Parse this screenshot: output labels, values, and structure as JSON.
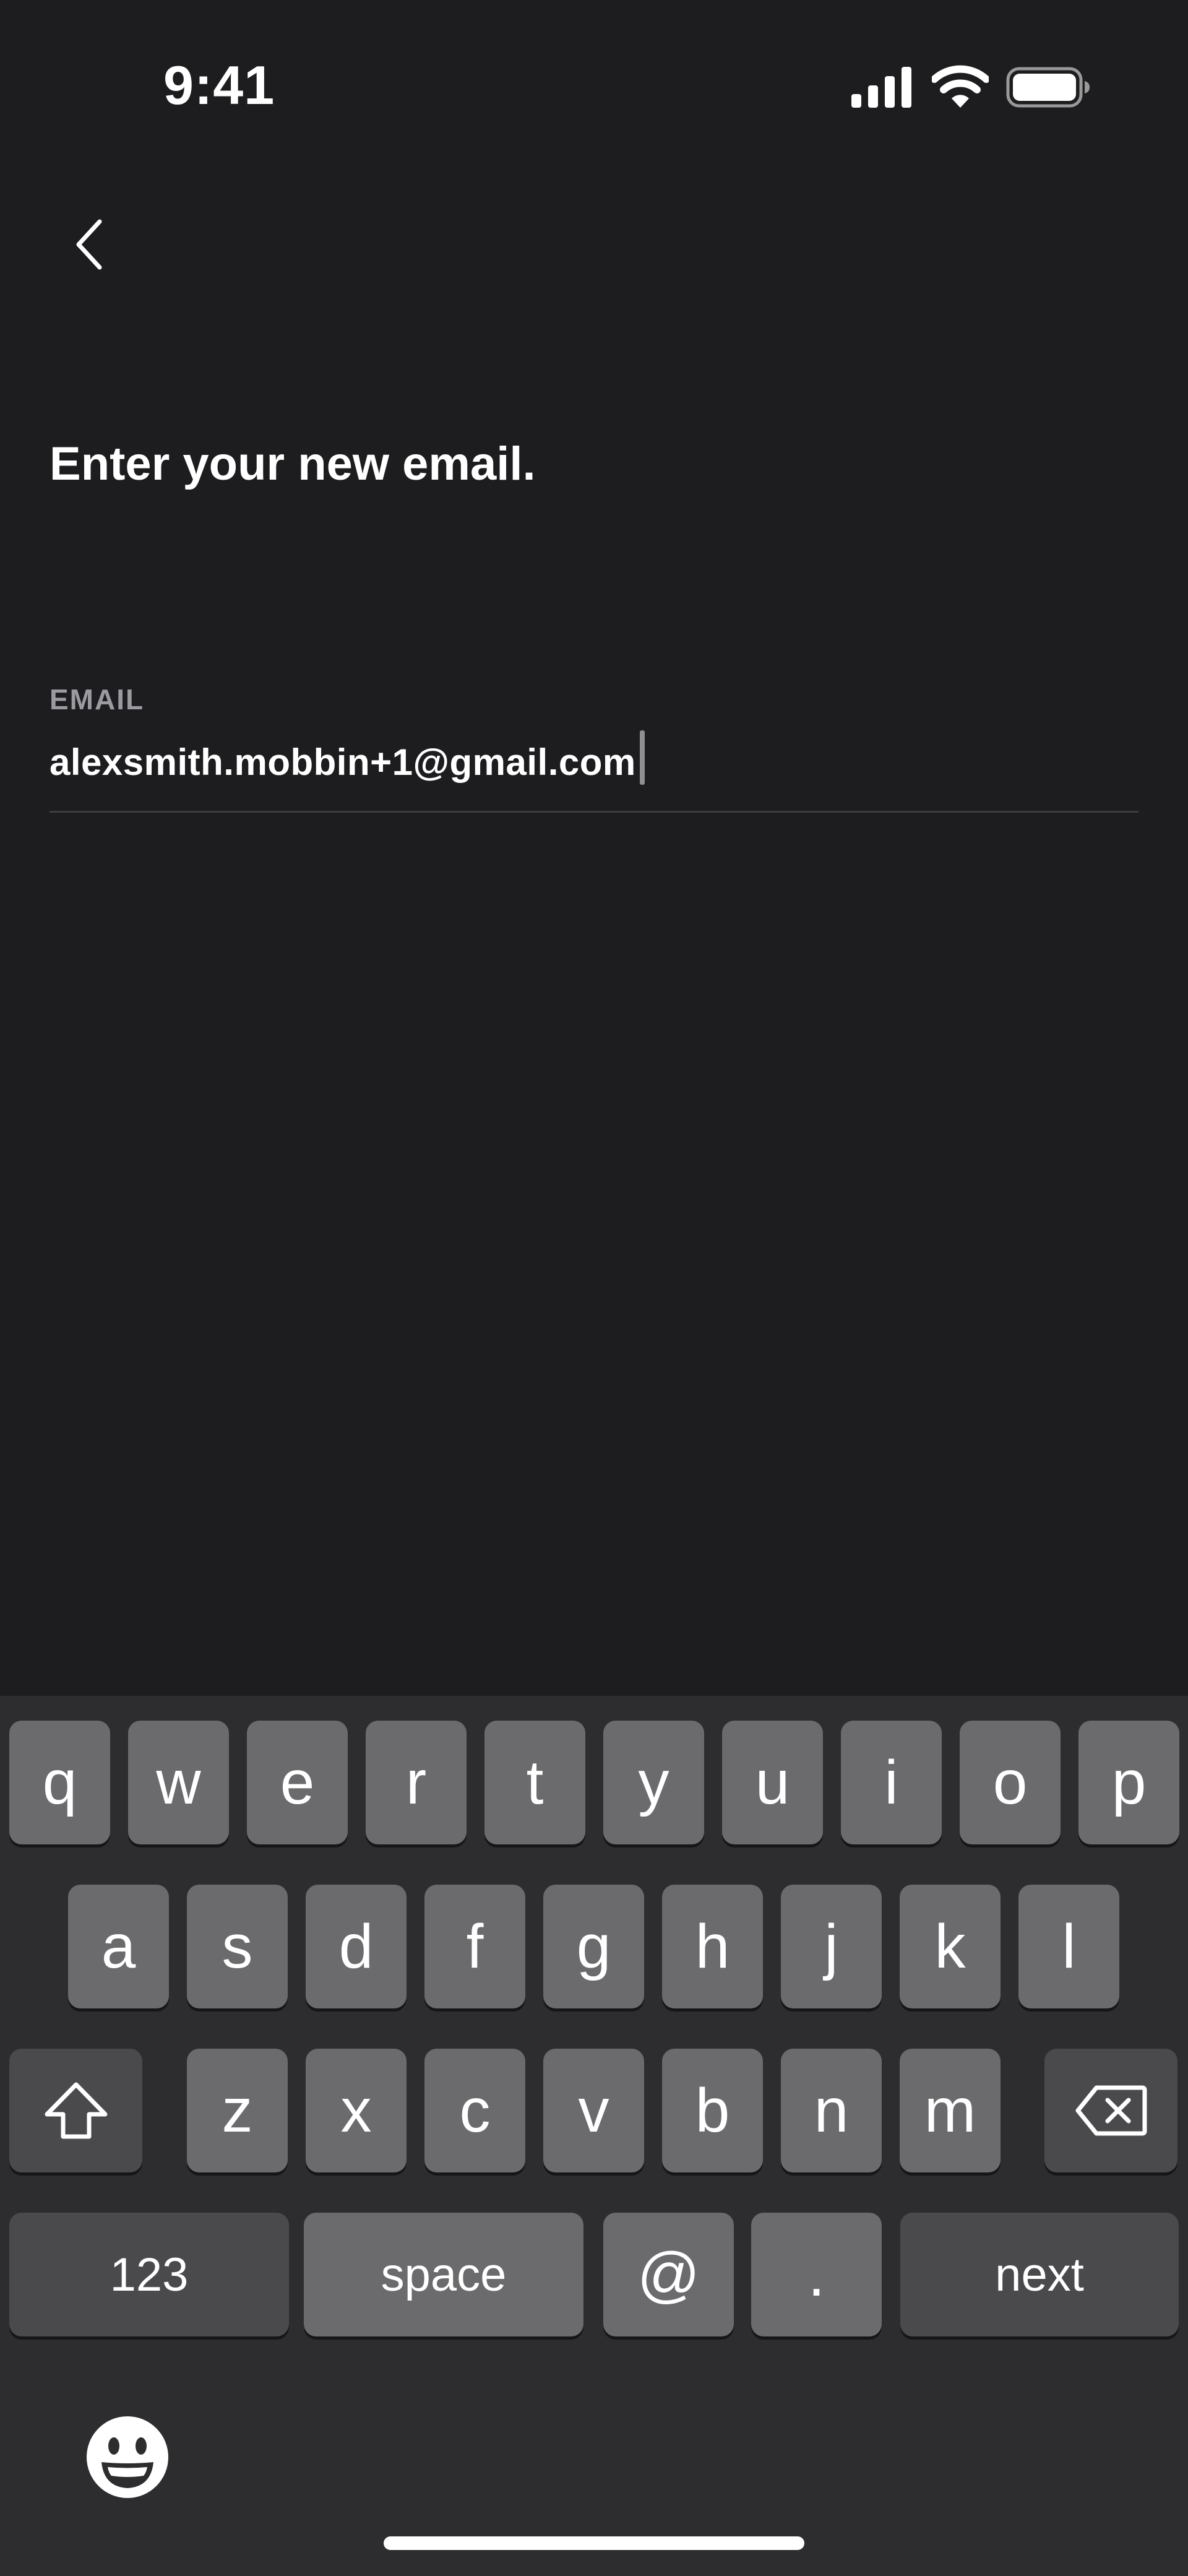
{
  "status_bar": {
    "time": "9:41",
    "icons": [
      "signal-icon",
      "wifi-icon",
      "battery-icon"
    ]
  },
  "nav": {
    "back_icon": "chevron-left-icon"
  },
  "content": {
    "title": "Enter your new email.",
    "email_label": "EMAIL",
    "email_value": "alexsmith.mobbin+1@gmail.com"
  },
  "keyboard": {
    "row1": [
      "q",
      "w",
      "e",
      "r",
      "t",
      "y",
      "u",
      "i",
      "o",
      "p"
    ],
    "row2": [
      "a",
      "s",
      "d",
      "f",
      "g",
      "h",
      "j",
      "k",
      "l"
    ],
    "row3": [
      "z",
      "x",
      "c",
      "v",
      "b",
      "n",
      "m"
    ],
    "shift_icon": "shift-icon",
    "delete_icon": "delete-icon",
    "numbers_label": "123",
    "space_label": "space",
    "at_label": "@",
    "dot_label": ".",
    "next_label": "next",
    "emoji_icon": "emoji-icon"
  },
  "colors": {
    "background": "#1d1d1f",
    "keyboard_background": "#2d2d2f",
    "letter_key": "#6b6b6e",
    "function_key": "#4a4a4d",
    "label_gray": "#9a9aa0"
  }
}
